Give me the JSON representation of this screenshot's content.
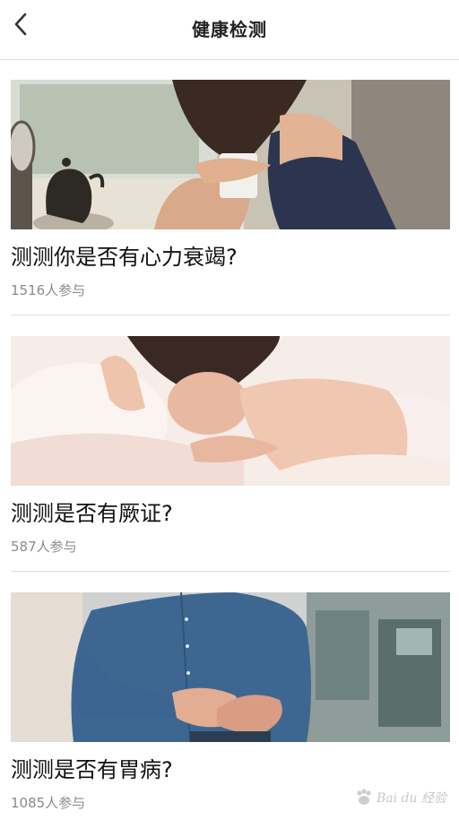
{
  "header": {
    "title": "健康检测",
    "back_icon": "chevron-left-icon"
  },
  "tests": [
    {
      "title": "测测你是否有心力衰竭?",
      "participants": "1516人参与"
    },
    {
      "title": "测测是否有厥证?",
      "participants": "587人参与"
    },
    {
      "title": "测测是否有胃病?",
      "participants": "1085人参与"
    }
  ],
  "watermark": {
    "text": "Bai du 经验"
  },
  "colors": {
    "title_text": "#111111",
    "count_text": "#8a8a8a",
    "divider": "#dcdcdc"
  }
}
